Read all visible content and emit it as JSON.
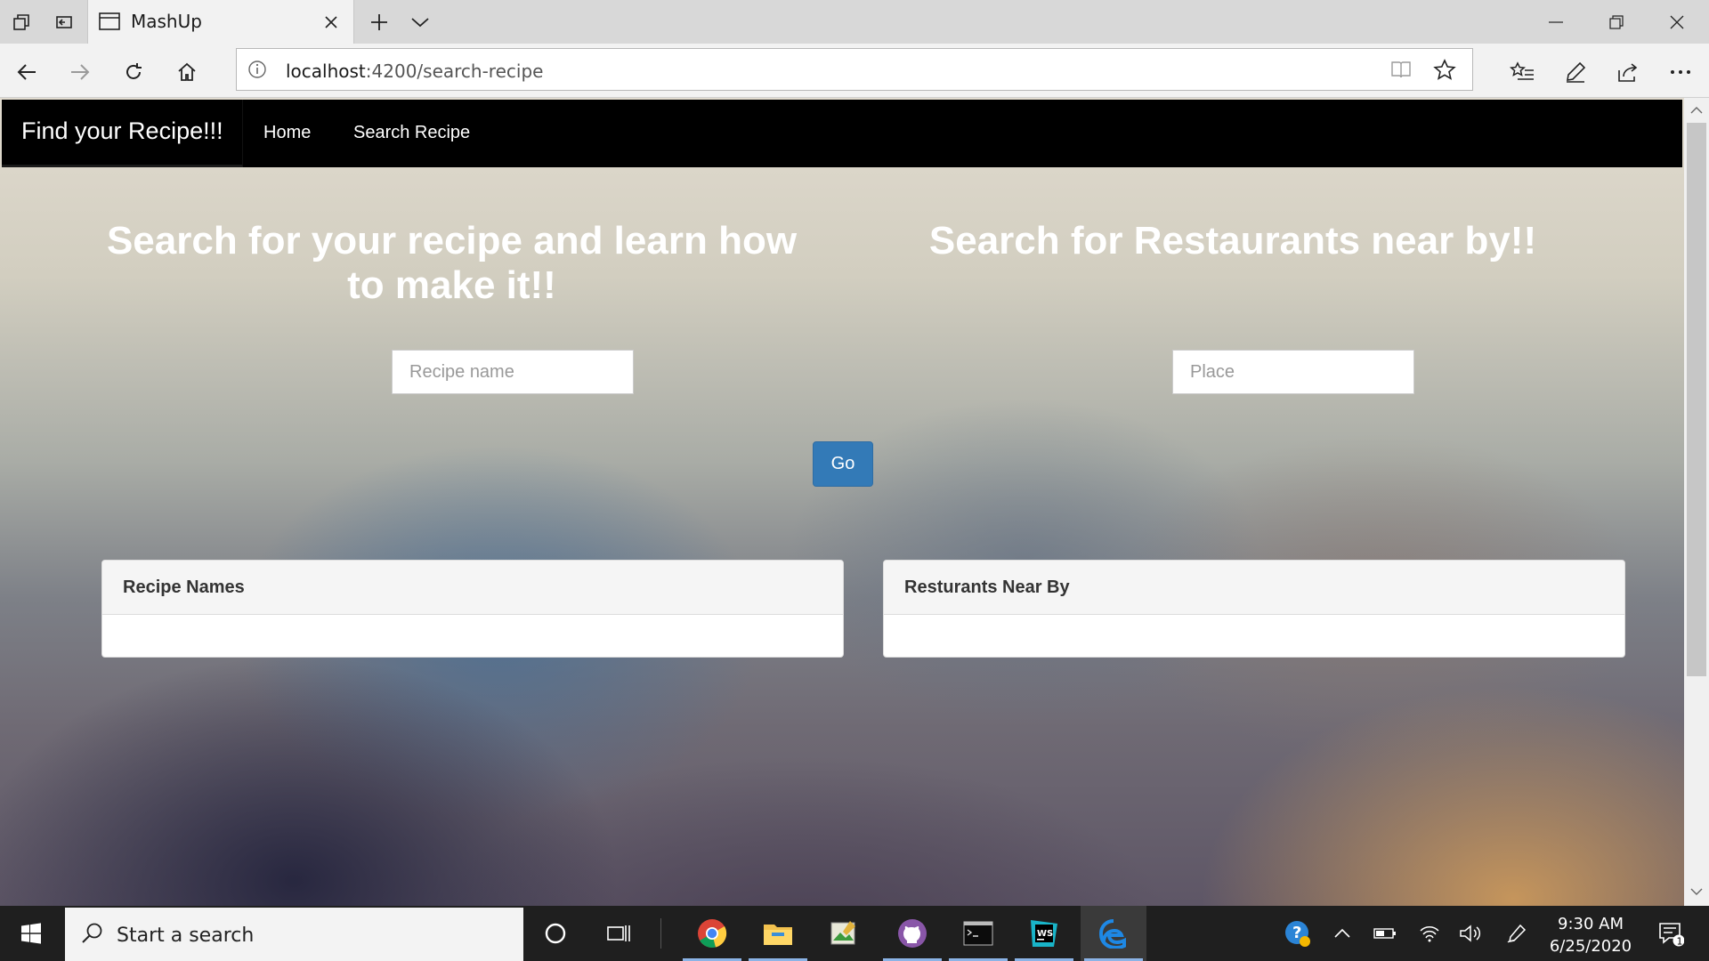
{
  "browser": {
    "tab_title": "MashUp",
    "url_host": "localhost",
    "url_path": ":4200/search-recipe"
  },
  "navbar": {
    "brand": "Find your Recipe!!!",
    "links": [
      "Home",
      "Search Recipe"
    ]
  },
  "recipe": {
    "heading_line1": "Search for your recipe and learn how",
    "heading_line2": "to make it!!",
    "placeholder": "Recipe name",
    "panel_title": "Recipe Names"
  },
  "restaurant": {
    "heading": "Search for Restaurants near by!!",
    "placeholder": "Place",
    "panel_title": "Resturants Near By"
  },
  "go_button": "Go",
  "taskbar": {
    "search_placeholder": "Start a search",
    "time": "9:30 AM",
    "date": "6/25/2020",
    "notification_count": "1"
  },
  "colors": {
    "navbar": "#000000",
    "go_button": "#337ab7",
    "taskbar": "#1f1f1f"
  }
}
